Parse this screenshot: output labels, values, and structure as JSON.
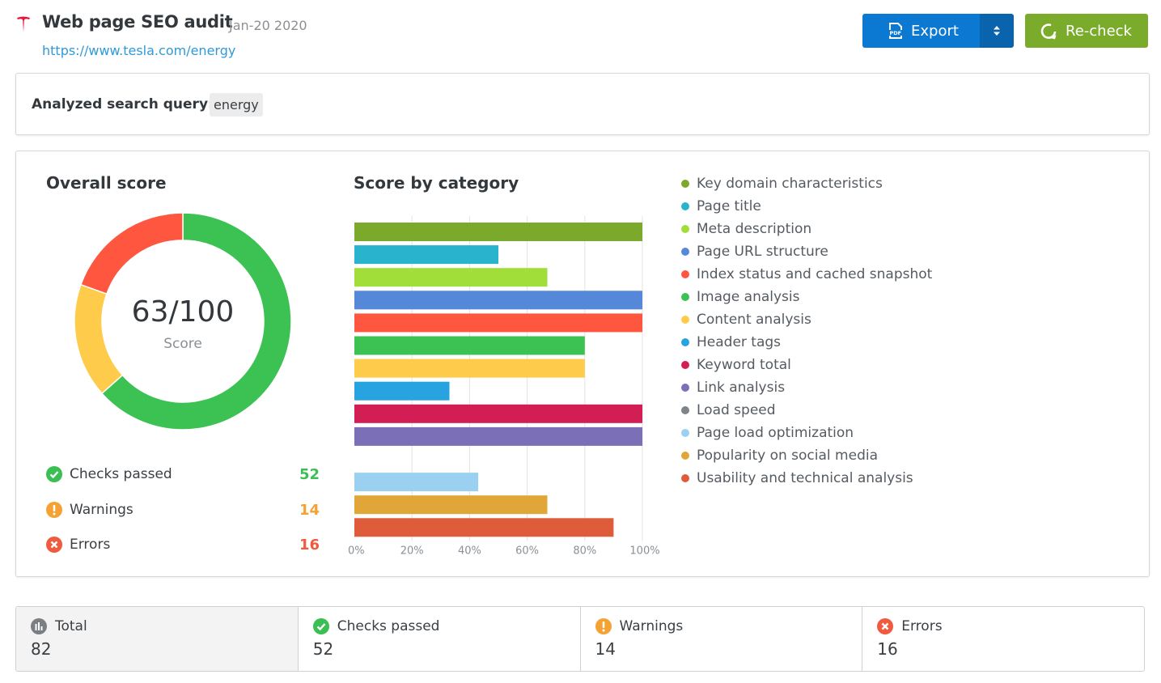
{
  "header": {
    "logo_icon": "tesla-logo-icon",
    "title": "Web page SEO audit",
    "date": "Jan-20 2020",
    "url": "https://www.tesla.com/energy",
    "export_label": "Export",
    "recheck_label": "Re-check"
  },
  "query": {
    "label": "Analyzed search query:",
    "value": "energy"
  },
  "overall": {
    "heading": "Overall score",
    "score_text": "63/100",
    "score_label": "Score",
    "stats": [
      {
        "label": "Checks passed",
        "value": "52",
        "color": "#3bbf52",
        "icon": "check-circle-icon"
      },
      {
        "label": "Warnings",
        "value": "14",
        "color": "#f4a233",
        "icon": "warning-circle-icon"
      },
      {
        "label": "Errors",
        "value": "16",
        "color": "#f05a3e",
        "icon": "error-circle-icon"
      }
    ]
  },
  "category": {
    "heading": "Score by category"
  },
  "summary": [
    {
      "label": "Total",
      "value": "82",
      "icon": "chart-circle-icon"
    },
    {
      "label": "Checks passed",
      "value": "52",
      "icon": "check-circle-icon"
    },
    {
      "label": "Warnings",
      "value": "14",
      "icon": "warning-circle-icon"
    },
    {
      "label": "Errors",
      "value": "16",
      "icon": "error-circle-icon"
    }
  ],
  "chart_data": [
    {
      "type": "pie",
      "title": "Overall score",
      "center_text": "63/100",
      "center_subtext": "Score",
      "slices": [
        {
          "name": "Checks passed",
          "value": 52,
          "color": "#3cc153"
        },
        {
          "name": "Warnings",
          "value": 14,
          "color": "#fecb4b"
        },
        {
          "name": "Errors",
          "value": 16,
          "color": "#ff5640"
        }
      ]
    },
    {
      "type": "bar",
      "orientation": "horizontal",
      "title": "Score by category",
      "xlabel": "",
      "ylabel": "",
      "xlim": [
        0,
        100
      ],
      "x_ticks": [
        "0%",
        "20%",
        "40%",
        "60%",
        "80%",
        "100%"
      ],
      "grid": true,
      "legend": "right",
      "categories": [
        "Key domain characteristics",
        "Page title",
        "Meta description",
        "Page URL structure",
        "Index status and cached snapshot",
        "Image analysis",
        "Content analysis",
        "Header tags",
        "Keyword total",
        "Link analysis",
        "Load speed",
        "Page load optimization",
        "Popularity on social media",
        "Usability and technical analysis"
      ],
      "values": [
        100,
        50,
        67,
        100,
        100,
        80,
        80,
        33,
        100,
        100,
        0,
        43,
        67,
        90
      ],
      "colors": [
        "#7aa92c",
        "#29b3cc",
        "#a2de3a",
        "#5688da",
        "#ff5640",
        "#3cc153",
        "#fecb4b",
        "#27a3e0",
        "#d21e54",
        "#7b70b8",
        "#7f8488",
        "#9bd1f0",
        "#e0a738",
        "#df5c3a"
      ]
    }
  ]
}
